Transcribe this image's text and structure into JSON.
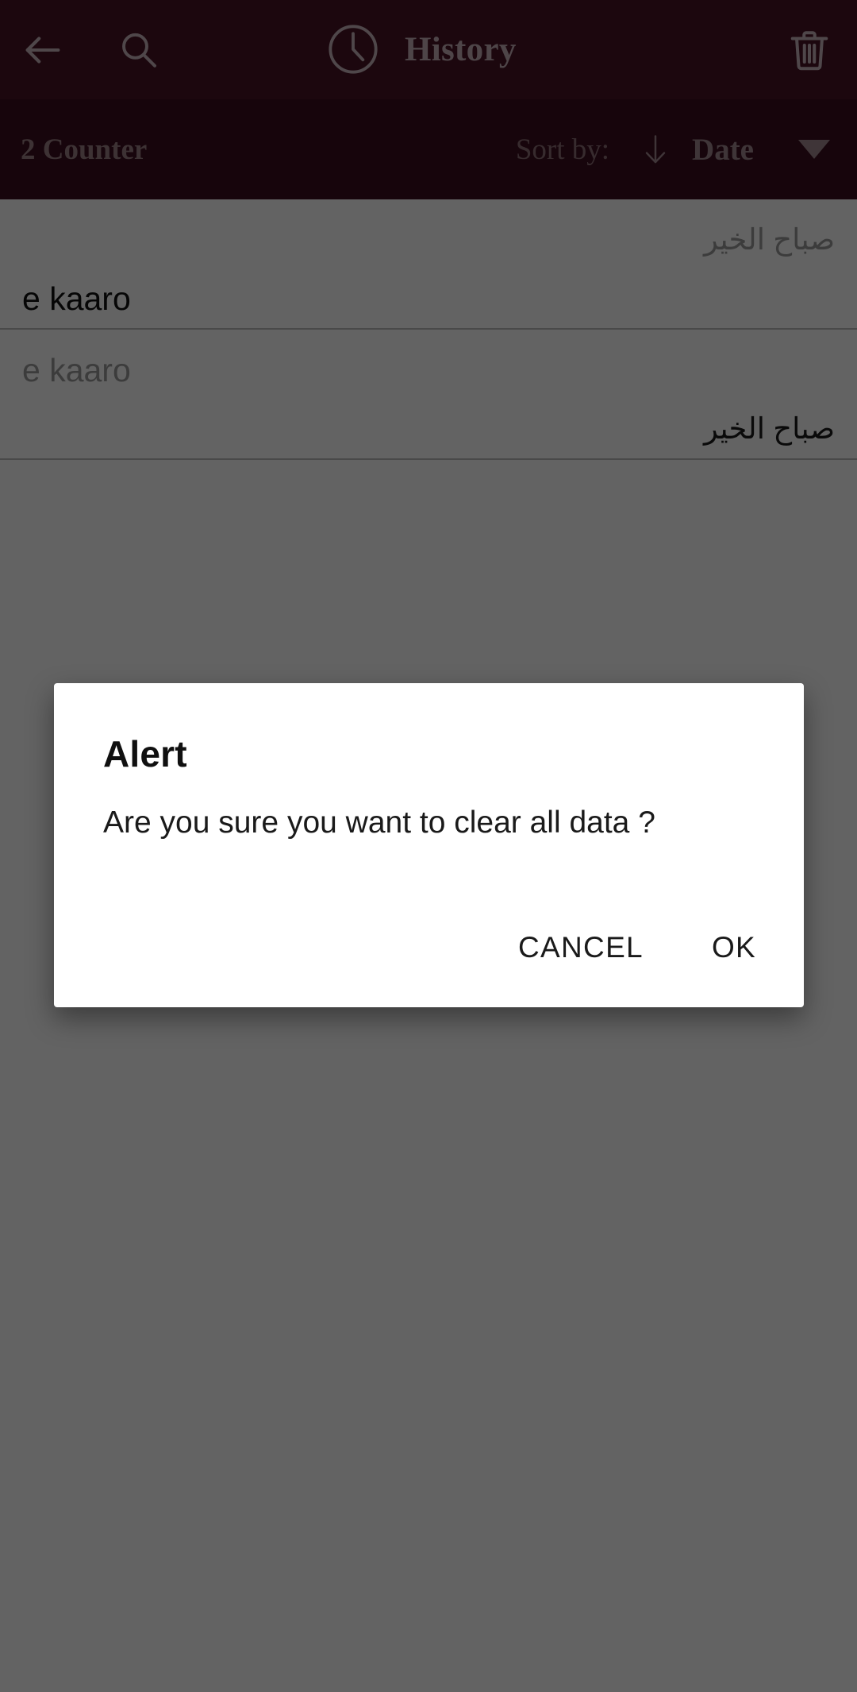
{
  "app_bar": {
    "back_icon": "arrow-left-icon",
    "search_icon": "search-icon",
    "clock_icon": "clock-icon",
    "title": "History",
    "delete_icon": "trash-icon"
  },
  "sort_bar": {
    "counter_label": "2 Counter",
    "sort_by_label": "Sort by:",
    "sort_direction_icon": "arrow-down-icon",
    "sort_field": "Date",
    "dropdown_icon": "caret-down-icon"
  },
  "history": {
    "items": [
      {
        "source_text": "صباح الخير",
        "target_text": "e kaaro"
      },
      {
        "source_text": "e kaaro",
        "target_text": "صباح الخير"
      }
    ]
  },
  "dialog": {
    "title": "Alert",
    "message": "Are you sure you want to clear all data ?",
    "cancel_label": "CANCEL",
    "ok_label": "OK"
  },
  "colors": {
    "app_bar": "#4A1226",
    "sort_bar": "#3D0E1F",
    "accent_text": "#C9B2BA",
    "scrim": "rgba(0,0,0,0.61)",
    "dialog_bg": "#FFFFFF"
  }
}
